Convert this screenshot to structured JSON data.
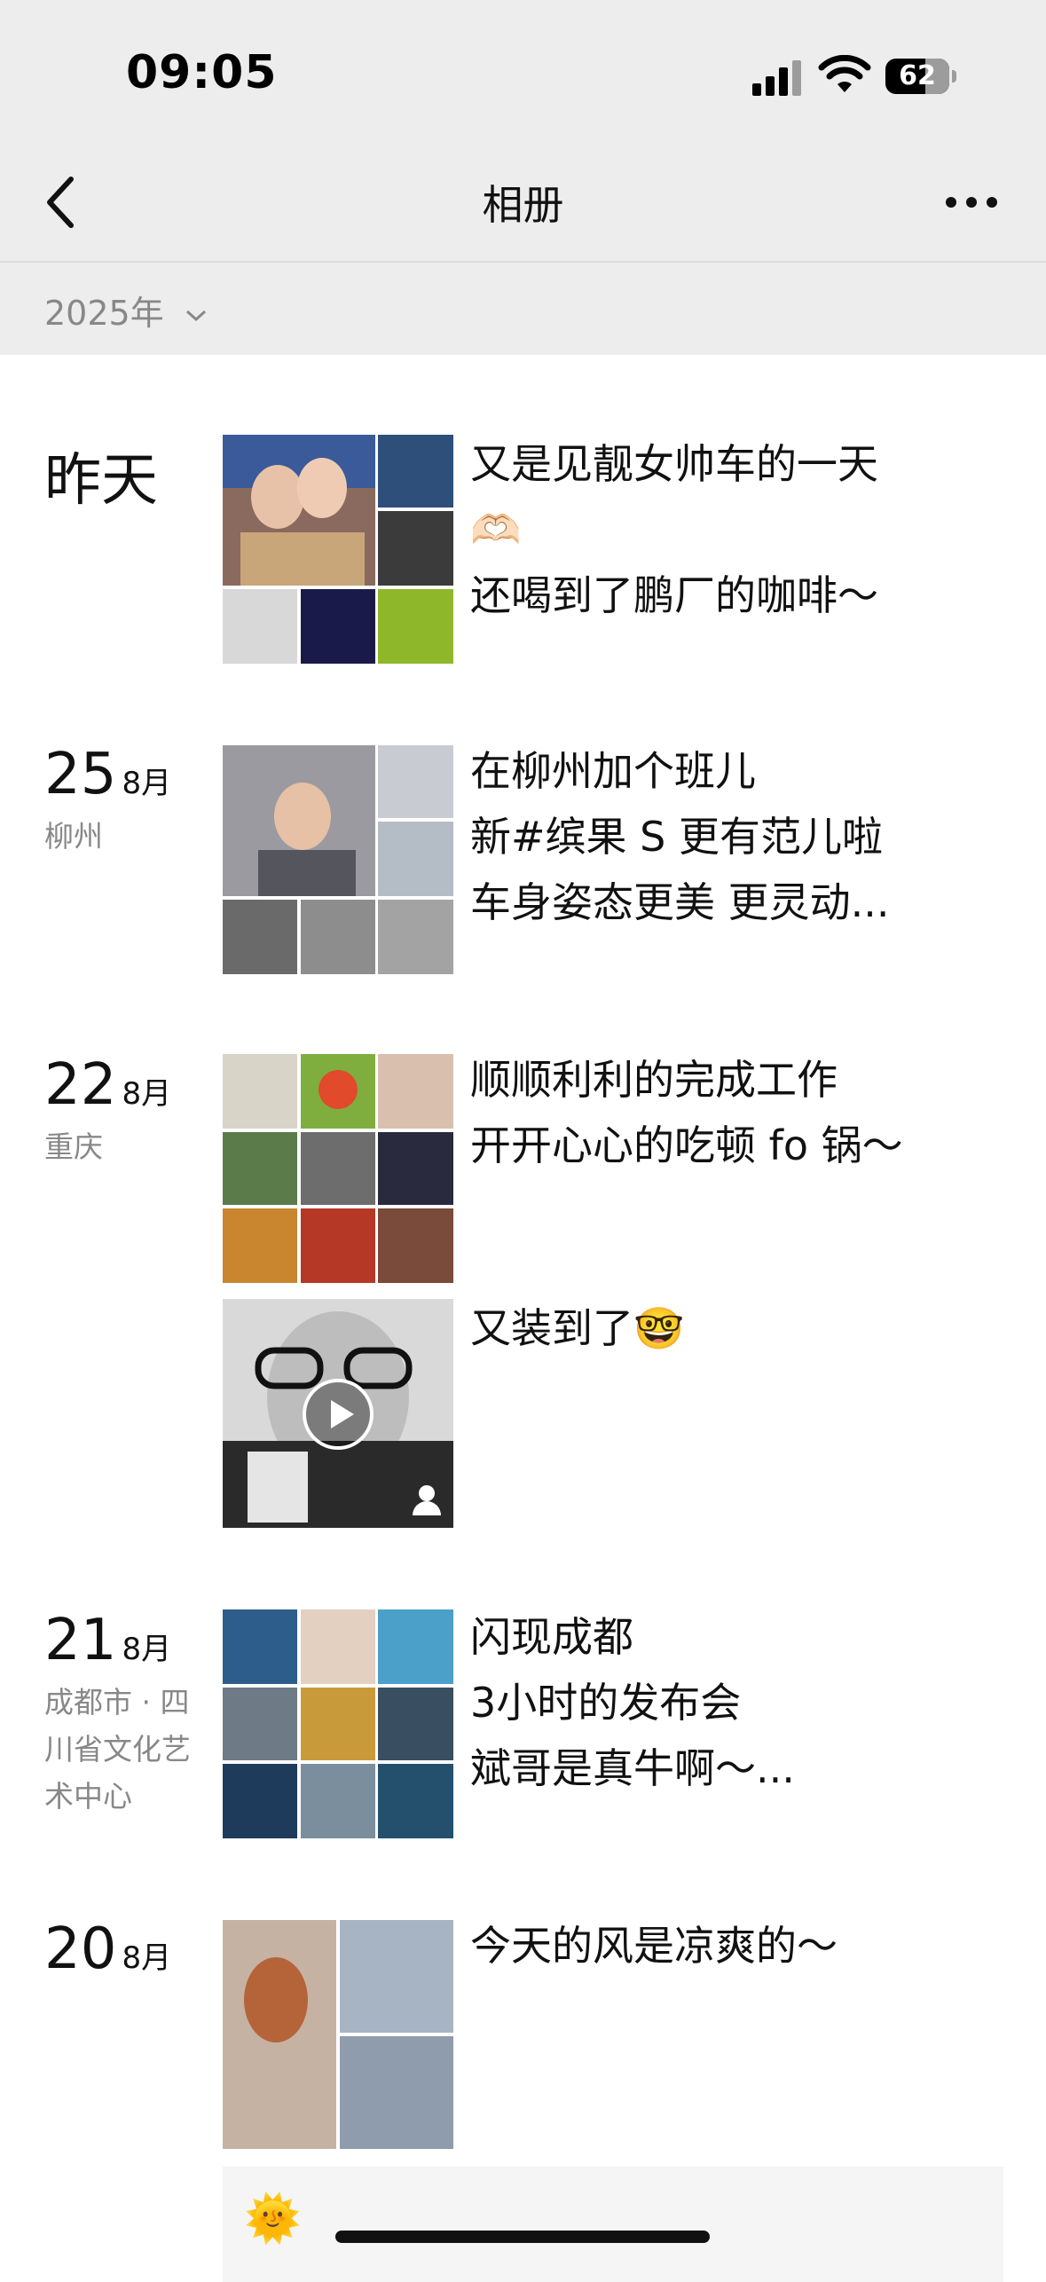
{
  "status_bar": {
    "time": "09:05",
    "battery": "62",
    "battery_level": 0.62
  },
  "nav": {
    "title": "相册",
    "back_icon": "chevron-left-icon",
    "more_icon": "ellipsis-icon"
  },
  "filter": {
    "year": "2025年"
  },
  "entries": [
    {
      "day_label": "昨天",
      "lines": [
        "又是见靓女帅车的一天",
        "🫶🏻",
        "还喝到了鹏厂的咖啡～"
      ]
    },
    {
      "day": "25",
      "month": "8月",
      "location": "柳州",
      "lines": [
        "在柳州加个班儿",
        "新#缤果 S 更有范儿啦",
        "车身姿态更美 更灵动..."
      ]
    },
    {
      "day": "22",
      "month": "8月",
      "location": "重庆",
      "lines": [
        "顺顺利利的完成工作",
        "开开心心的吃顿 fo 锅～"
      ]
    },
    {
      "video_caption": "又装到了🤓"
    },
    {
      "day": "21",
      "month": "8月",
      "location_lines": [
        "成都市 · 四",
        "川省文化艺",
        "术中心"
      ],
      "lines": [
        "闪现成都",
        "3小时的发布会",
        "斌哥是真牛啊～..."
      ]
    },
    {
      "day": "20",
      "month": "8月",
      "lines": [
        "今天的风是凉爽的～"
      ]
    }
  ],
  "bottom_card": {
    "emoji": "🌞"
  },
  "colors": {
    "nav_bg": "#ededed",
    "text": "#111111",
    "secondary": "#888888"
  }
}
